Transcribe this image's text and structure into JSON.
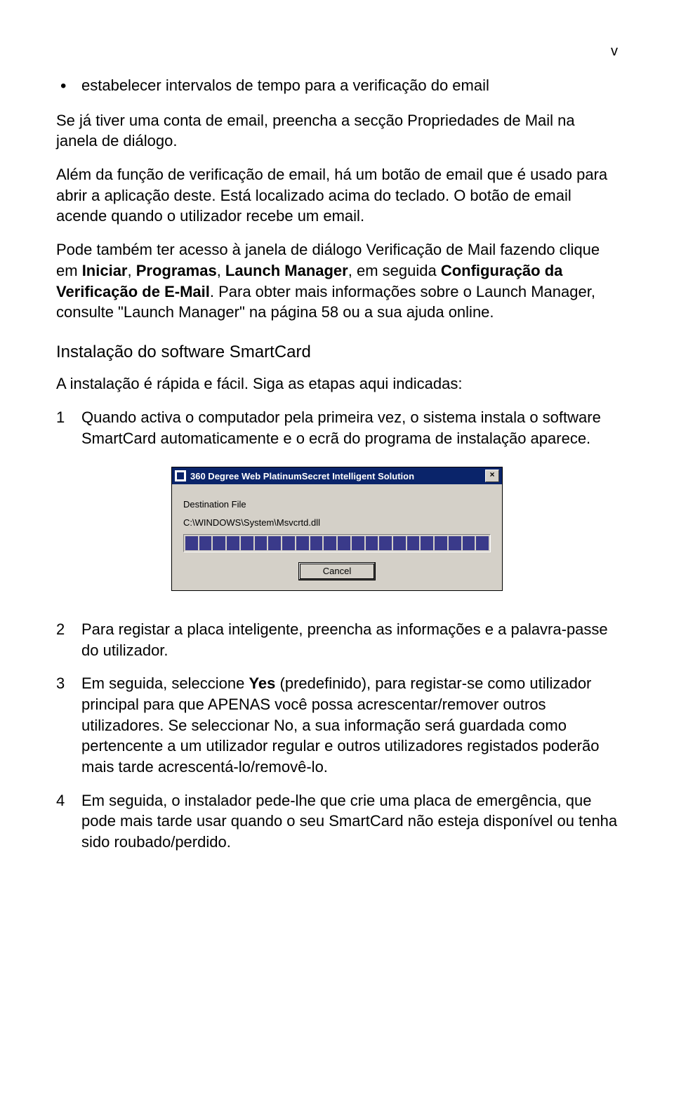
{
  "page_number": "v",
  "bullet1": "estabelecer intervalos de tempo para a verificação do email",
  "para1": "Se já tiver uma conta de email, preencha a secção Propriedades de Mail na janela de diálogo.",
  "para2": "Além da função de verificação de email, há um botão de email que é usado para abrir a aplicação deste. Está localizado acima do teclado. O botão de email acende quando o utilizador recebe um email.",
  "para3_a": "Pode também ter acesso à janela de diálogo Verificação de Mail fazendo clique em ",
  "para3_b1": "Iniciar",
  "para3_c1": ", ",
  "para3_b2": "Programas",
  "para3_c2": ", ",
  "para3_b3": "Launch Manager",
  "para3_c3": ", em seguida ",
  "para3_b4": "Configuração da Verificação de E-Mail",
  "para3_d": ". Para obter mais informações sobre o Launch Manager, consulte \"Launch Manager\" na página 58 ou a sua ajuda online.",
  "subhead": "Instalação do software SmartCard",
  "para4": "A instalação é rápida e fácil. Siga as etapas aqui indicadas:",
  "step1_num": "1",
  "step1_txt": "Quando activa o computador pela primeira vez, o sistema instala o software SmartCard automaticamente e o ecrã do programa de instalação aparece.",
  "dialog": {
    "title": "360 Degree Web PlatinumSecret Intelligent Solution",
    "label": "Destination File",
    "path": "C:\\WINDOWS\\System\\Msvcrtd.dll",
    "cancel": "Cancel"
  },
  "step2_num": "2",
  "step2_txt": "Para registar a placa inteligente, preencha as informações e a palavra-passe do utilizador.",
  "step3_num": "3",
  "step3_a": "Em seguida, seleccione ",
  "step3_b": "Yes",
  "step3_c": " (predefinido), para registar-se como utilizador principal para que APENAS você possa acrescentar/remover outros utilizadores. Se seleccionar No, a sua informação será guardada como pertencente a um utilizador regular e outros utilizadores registados poderão mais tarde acrescentá-lo/removê-lo.",
  "step4_num": "4",
  "step4_txt": "Em seguida, o instalador pede-lhe que crie uma placa de emergência, que pode mais tarde usar quando o seu SmartCard não esteja disponível ou tenha sido roubado/perdido."
}
